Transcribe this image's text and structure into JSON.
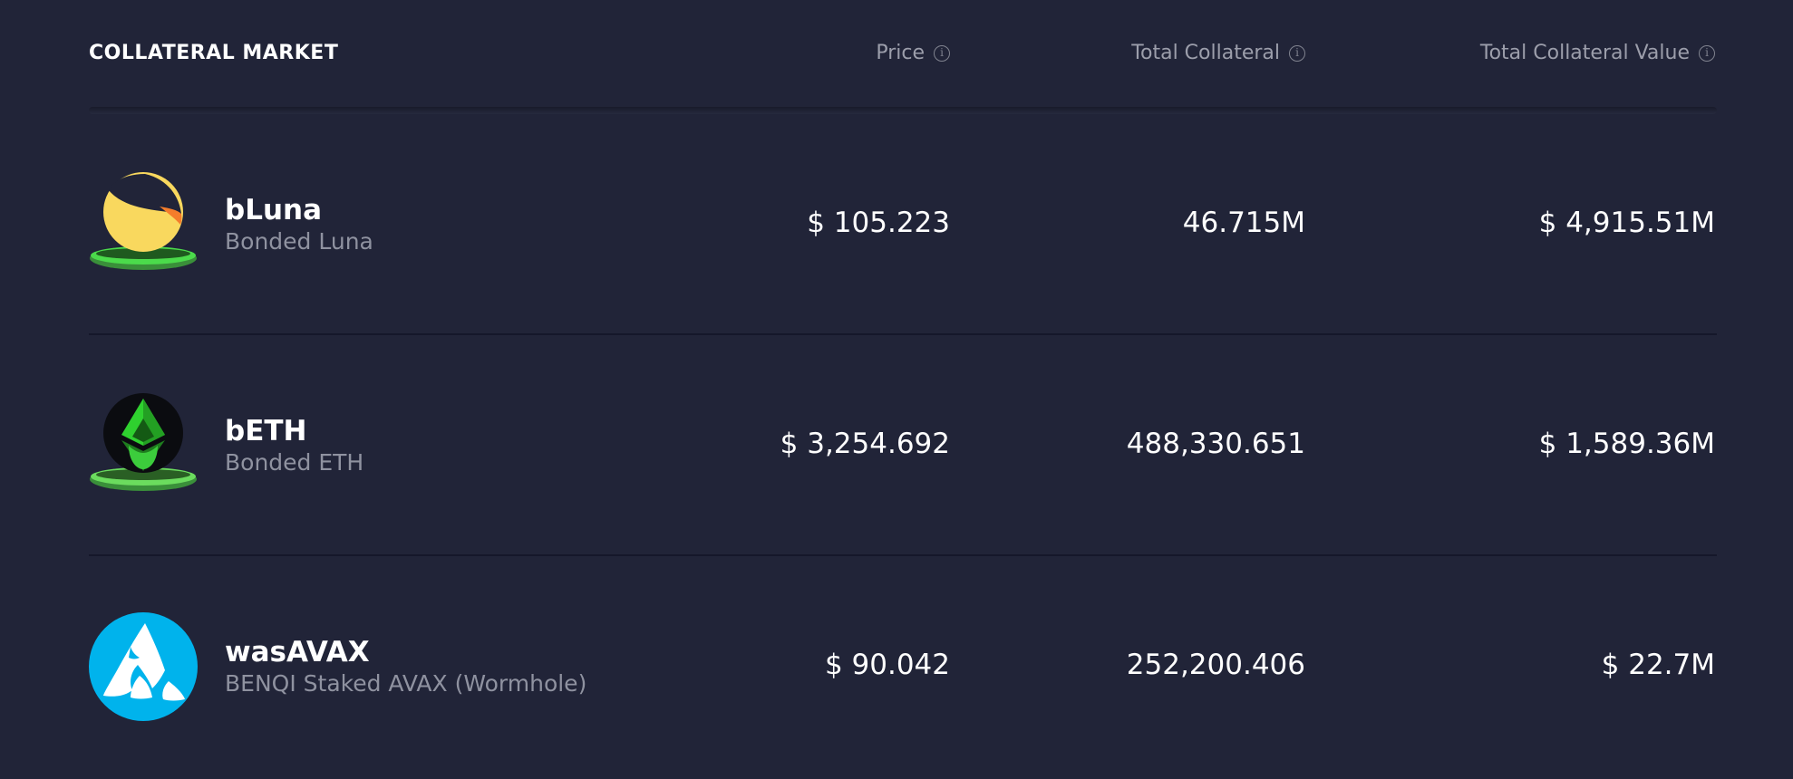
{
  "header": {
    "title": "COLLATERAL MARKET",
    "price_label": "Price",
    "total_collateral_label": "Total Collateral",
    "total_collateral_value_label": "Total Collateral Value",
    "info_glyph": "i"
  },
  "rows": [
    {
      "symbol": "bLuna",
      "name": "Bonded Luna",
      "price": "$ 105.223",
      "total_collateral": "46.715M",
      "total_collateral_value": "$ 4,915.51M",
      "icon": "bluna-token-icon"
    },
    {
      "symbol": "bETH",
      "name": "Bonded ETH",
      "price": "$ 3,254.692",
      "total_collateral": "488,330.651",
      "total_collateral_value": "$ 1,589.36M",
      "icon": "beth-token-icon"
    },
    {
      "symbol": "wasAVAX",
      "name": "BENQI Staked AVAX (Wormhole)",
      "price": "$ 90.042",
      "total_collateral": "252,200.406",
      "total_collateral_value": "$ 22.7M",
      "icon": "wasavax-token-icon"
    }
  ],
  "colors": {
    "background": "#212438",
    "muted_text": "#8f92a0",
    "luna_yellow": "#f9d85e",
    "anchor_green": "#4bdb4b",
    "benqi_blue": "#00b3ec"
  }
}
